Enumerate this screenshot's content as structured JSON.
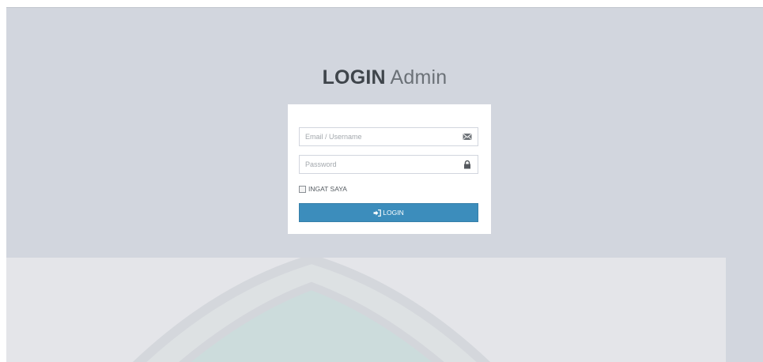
{
  "header": {
    "title_bold": "LOGIN",
    "title_light": "Admin"
  },
  "form": {
    "email_placeholder": "Email / Username",
    "email_value": "",
    "email_icon": "envelope-icon",
    "password_placeholder": "Password",
    "password_value": "",
    "password_icon": "lock-icon",
    "remember_label": "INGAT SAYA",
    "remember_checked": false,
    "submit_label": "LOGIN",
    "submit_icon": "sign-in-icon"
  },
  "colors": {
    "page_background": "#d2d6de",
    "button_primary": "#3c8dbc",
    "card_background": "#ffffff"
  }
}
